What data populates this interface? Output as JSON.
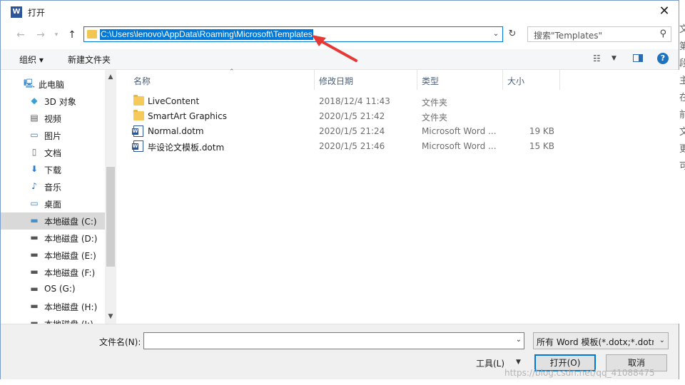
{
  "titlebar": {
    "app_icon_text": "W",
    "title": "打开",
    "close_glyph": "✕"
  },
  "address": {
    "path": "C:\\Users\\lenovo\\AppData\\Roaming\\Microsoft\\Templates",
    "search_placeholder": "搜索\"Templates\""
  },
  "annotation_arrow_color": "#e53935",
  "toolbar": {
    "organize": "组织 ▾",
    "new_folder": "新建文件夹",
    "help": "?"
  },
  "nav": {
    "items": [
      {
        "label": "此电脑",
        "icon": "pc-icon"
      },
      {
        "label": "3D 对象",
        "icon": "3d-objects-icon"
      },
      {
        "label": "视频",
        "icon": "video-icon"
      },
      {
        "label": "图片",
        "icon": "pictures-icon"
      },
      {
        "label": "文档",
        "icon": "documents-icon"
      },
      {
        "label": "下载",
        "icon": "download-icon"
      },
      {
        "label": "音乐",
        "icon": "music-icon"
      },
      {
        "label": "桌面",
        "icon": "desktop-icon"
      },
      {
        "label": "本地磁盘 (C:)",
        "icon": "system-drive-icon",
        "selected": true
      },
      {
        "label": "本地磁盘 (D:)",
        "icon": "drive-icon"
      },
      {
        "label": "本地磁盘 (E:)",
        "icon": "drive-icon"
      },
      {
        "label": "本地磁盘 (F:)",
        "icon": "drive-icon"
      },
      {
        "label": "OS (G:)",
        "icon": "drive-icon"
      },
      {
        "label": "本地磁盘 (H:)",
        "icon": "drive-icon"
      },
      {
        "label": "本地磁盘 (I:)",
        "icon": "drive-icon"
      }
    ]
  },
  "columns": {
    "name": "名称",
    "modified": "修改日期",
    "type": "类型",
    "size": "大小"
  },
  "files": [
    {
      "name": "LiveContent",
      "modified": "2018/12/4 11:43",
      "type": "文件夹",
      "size": "",
      "kind": "folder"
    },
    {
      "name": "SmartArt Graphics",
      "modified": "2020/1/5 21:42",
      "type": "文件夹",
      "size": "",
      "kind": "folder"
    },
    {
      "name": "Normal.dotm",
      "modified": "2020/1/5 21:24",
      "type": "Microsoft Word ...",
      "size": "19 KB",
      "kind": "word"
    },
    {
      "name": "毕设论文模板.dotm",
      "modified": "2020/1/5 21:46",
      "type": "Microsoft Word ...",
      "size": "15 KB",
      "kind": "word"
    }
  ],
  "bottom": {
    "filename_label": "文件名(N):",
    "filename_value": "",
    "filetype": "所有 Word 模板(*.dotx;*.dotm",
    "tools": "工具(L)",
    "open": "打开(O)",
    "cancel": "取消",
    "watermark": "https://blog.csdn.net/qq_41088475"
  },
  "right_edge_chars": [
    "文",
    "第",
    "段",
    "主",
    "在",
    "前",
    "文",
    "更",
    "可"
  ]
}
